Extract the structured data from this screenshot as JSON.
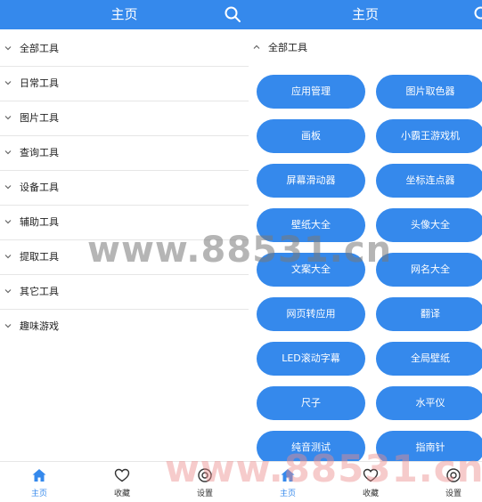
{
  "left": {
    "header": {
      "title": "主页",
      "search_icon": "search-icon"
    },
    "categories": [
      {
        "label": "全部工具"
      },
      {
        "label": "日常工具"
      },
      {
        "label": "图片工具"
      },
      {
        "label": "查询工具"
      },
      {
        "label": "设备工具"
      },
      {
        "label": "辅助工具"
      },
      {
        "label": "提取工具"
      },
      {
        "label": "其它工具"
      },
      {
        "label": "趣味游戏"
      }
    ],
    "nav": [
      {
        "label": "主页",
        "icon": "home-icon",
        "active": true
      },
      {
        "label": "收藏",
        "icon": "heart-icon",
        "active": false
      },
      {
        "label": "设置",
        "icon": "settings-icon",
        "active": false
      }
    ]
  },
  "right": {
    "header": {
      "title": "主页",
      "search_icon": "search-icon"
    },
    "expanded_category": "全部工具",
    "tools": [
      "应用管理",
      "图片取色器",
      "画板",
      "小霸王游戏机",
      "屏幕滑动器",
      "坐标连点器",
      "壁纸大全",
      "头像大全",
      "文案大全",
      "网名大全",
      "网页转应用",
      "翻译",
      "LED滚动字幕",
      "全局壁纸",
      "尺子",
      "水平仪",
      "纯音测试",
      "指南针"
    ],
    "nav": [
      {
        "label": "主页",
        "icon": "home-icon",
        "active": true
      },
      {
        "label": "收藏",
        "icon": "heart-icon",
        "active": false
      },
      {
        "label": "设置",
        "icon": "settings-icon",
        "active": false
      }
    ]
  },
  "watermarks": [
    "www.88531.cn",
    "www.88531.cn"
  ],
  "colors": {
    "accent": "#3589EC",
    "divider": "#e6e6e6"
  }
}
